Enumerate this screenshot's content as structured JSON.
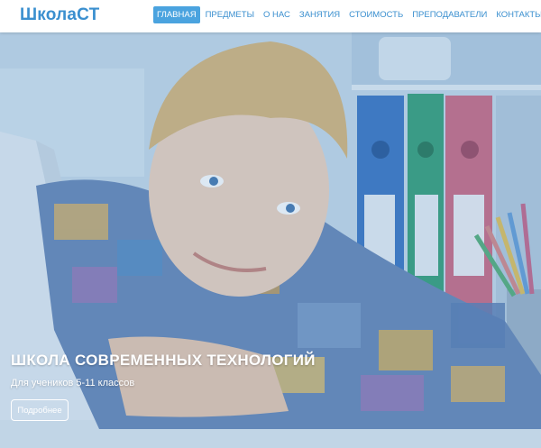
{
  "brand": {
    "logo": "ШколаСТ"
  },
  "nav": {
    "items": [
      {
        "label": "ГЛАВНАЯ",
        "active": true
      },
      {
        "label": "ПРЕДМЕТЫ",
        "active": false
      },
      {
        "label": "О НАС",
        "active": false
      },
      {
        "label": "ЗАНЯТИЯ",
        "active": false
      },
      {
        "label": "СТОИМОСТЬ",
        "active": false
      },
      {
        "label": "ПРЕПОДАВАТЕЛИ",
        "active": false
      },
      {
        "label": "КОНТАКТЫ",
        "active": false
      }
    ]
  },
  "hero": {
    "title": "ШКОЛА СОВРЕМЕННЫХ ТЕХНОЛОГИЙ",
    "subtitle": "Для учеников 5-11 классов",
    "button_label": "Подробнее"
  },
  "colors": {
    "accent": "#3a8fcf",
    "nav_active_bg": "#4aa3df",
    "hero_tint": "#bcd2e4"
  }
}
